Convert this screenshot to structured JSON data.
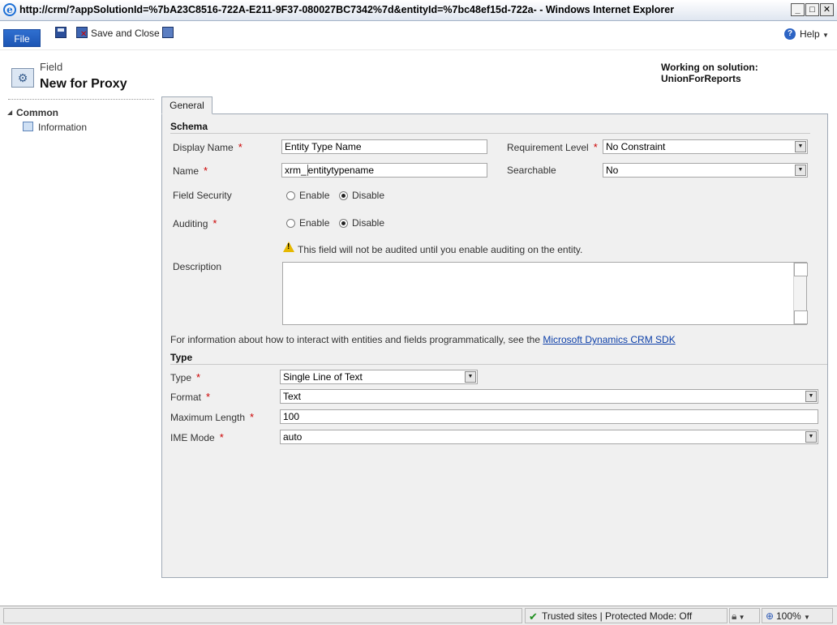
{
  "window": {
    "title": "http://crm/?appSolutionId=%7bA23C8516-722A-E211-9F37-080027BC7342%7d&entityId=%7bc48ef15d-722a- - Windows Internet Explorer",
    "min": "_",
    "max": "□",
    "close": "✕"
  },
  "ribbon": {
    "file_label": "File",
    "save_and_close_label": "Save and Close",
    "help_label": "Help"
  },
  "header": {
    "kind": "Field",
    "title": "New for Proxy",
    "solution": "Working on solution: UnionForReports"
  },
  "nav": {
    "section": "Common",
    "item": "Information"
  },
  "tabs": [
    {
      "label": "General"
    }
  ],
  "schema": {
    "title": "Schema",
    "display_name_label": "Display Name",
    "display_name_value": "Entity Type Name",
    "name_label": "Name",
    "name_prefix": "xrm_",
    "name_value": "entitytypename",
    "requirement_label": "Requirement Level",
    "requirement_value": "No Constraint",
    "searchable_label": "Searchable",
    "searchable_value": "No",
    "field_security_label": "Field Security",
    "auditing_label": "Auditing",
    "enable_label": "Enable",
    "disable_label": "Disable",
    "field_security_selected": "Disable",
    "auditing_selected": "Disable",
    "audit_warning": "This field will not be audited until you enable auditing on the entity.",
    "description_label": "Description",
    "description_value": ""
  },
  "info": {
    "text": "For information about how to interact with entities and fields programmatically, see the",
    "link": "Microsoft Dynamics CRM SDK"
  },
  "type_section": {
    "title": "Type",
    "type_label": "Type",
    "type_value": "Single Line of Text",
    "format_label": "Format",
    "format_value": "Text",
    "max_length_label": "Maximum Length",
    "max_length_value": "100",
    "ime_mode_label": "IME Mode",
    "ime_mode_value": "auto"
  },
  "status": {
    "zone": "Trusted sites | Protected Mode: Off",
    "zoom": "100%"
  },
  "colors": {
    "accent": "#1c55b4",
    "required": "#cc0000",
    "link": "#0b3ea8",
    "panel": "#f0f0f0"
  },
  "icons": [
    "ie-icon",
    "save-icon",
    "save-close-icon",
    "saveas-icon",
    "help-icon",
    "field-entity-icon",
    "info-page-icon",
    "warning-icon",
    "trusted-check-icon",
    "globe-icon",
    "zoom-icon"
  ]
}
